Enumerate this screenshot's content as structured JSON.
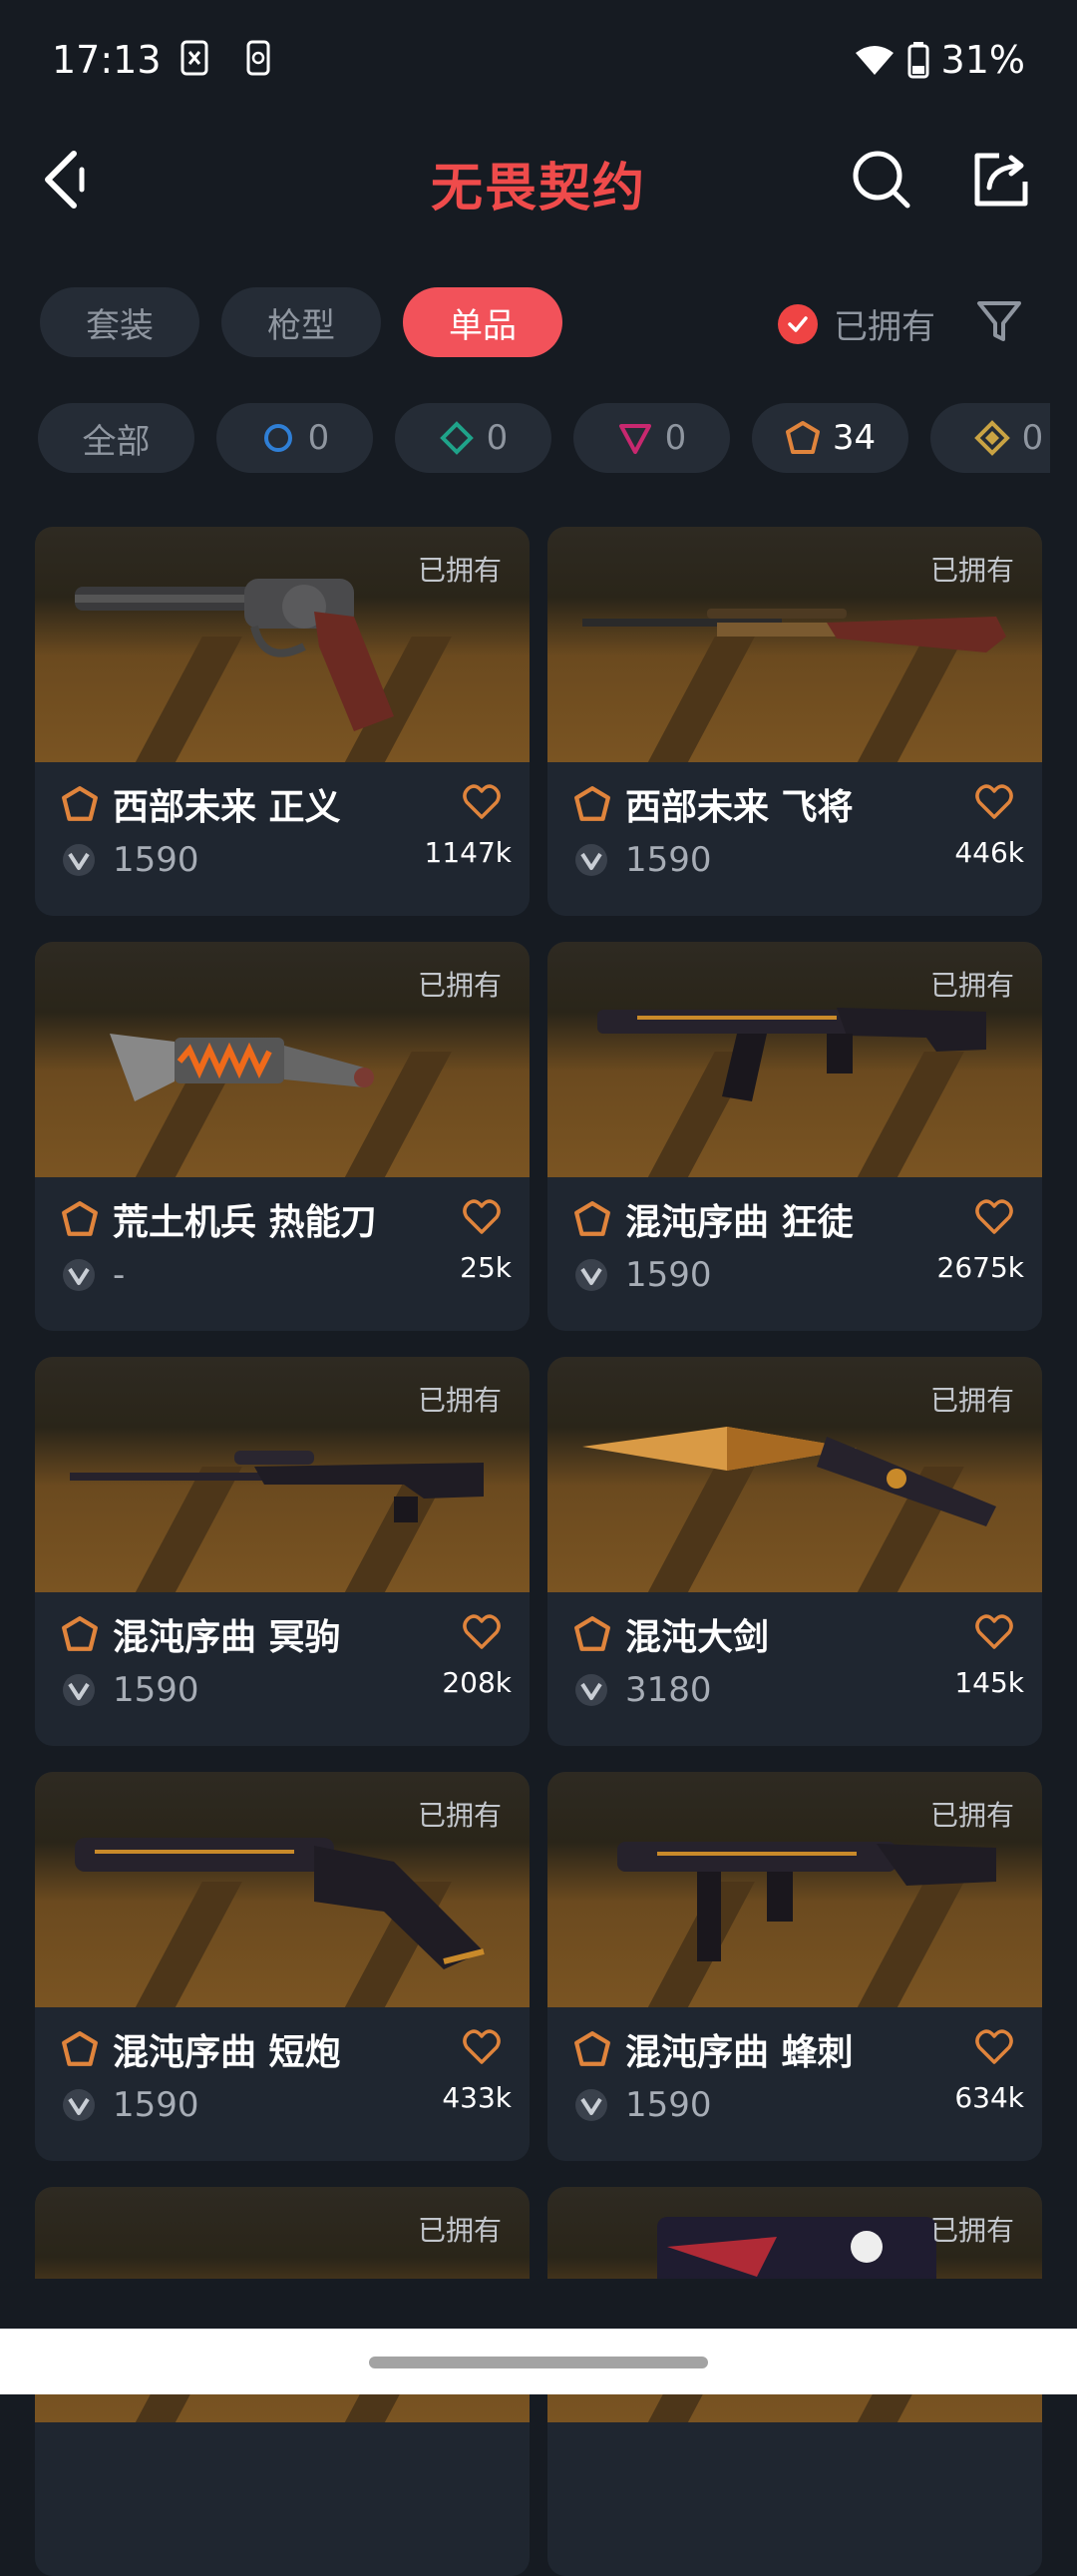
{
  "status": {
    "time": "17:13",
    "battery": "31%"
  },
  "header": {
    "title": "无畏契约"
  },
  "tabs": [
    {
      "label": "套装",
      "active": false
    },
    {
      "label": "枪型",
      "active": false
    },
    {
      "label": "单品",
      "active": true
    }
  ],
  "owned_filter": {
    "label": "已拥有",
    "checked": true
  },
  "rarity_chips": [
    {
      "label": "全部",
      "color": ""
    },
    {
      "count": "0",
      "color": "#2f7fd6",
      "icon": "select-tier-icon"
    },
    {
      "count": "0",
      "color": "#1fa38a",
      "icon": "deluxe-tier-icon"
    },
    {
      "count": "0",
      "color": "#c8286f",
      "icon": "premium-tier-icon"
    },
    {
      "count": "34",
      "color": "#e0843c",
      "icon": "exclusive-tier-icon",
      "selected": true
    },
    {
      "count": "0",
      "color": "#c9a343",
      "icon": "ultra-tier-icon"
    }
  ],
  "cards": [
    {
      "owned": "已拥有",
      "name": "西部未来 正义",
      "price": "1590",
      "likes": "1147k",
      "weapon": "revolver"
    },
    {
      "owned": "已拥有",
      "name": "西部未来 飞将",
      "price": "1590",
      "likes": "446k",
      "weapon": "rifle-wood"
    },
    {
      "owned": "已拥有",
      "name": "荒土机兵 热能刀",
      "price": "-",
      "likes": "25k",
      "weapon": "knife"
    },
    {
      "owned": "已拥有",
      "name": "混沌序曲 狂徒",
      "price": "1590",
      "likes": "2675k",
      "weapon": "vandal"
    },
    {
      "owned": "已拥有",
      "name": "混沌序曲 冥驹",
      "price": "1590",
      "likes": "208k",
      "weapon": "sniper"
    },
    {
      "owned": "已拥有",
      "name": "混沌大剑",
      "price": "3180",
      "likes": "145k",
      "weapon": "sword"
    },
    {
      "owned": "已拥有",
      "name": "混沌序曲 短炮",
      "price": "1590",
      "likes": "433k",
      "weapon": "shotgun"
    },
    {
      "owned": "已拥有",
      "name": "混沌序曲 蜂刺",
      "price": "1590",
      "likes": "634k",
      "weapon": "smg"
    },
    {
      "owned": "已拥有",
      "name": "",
      "price": "",
      "likes": "",
      "weapon": "partial-green"
    },
    {
      "owned": "已拥有",
      "name": "",
      "price": "",
      "likes": "",
      "weapon": "partial-edg"
    }
  ],
  "colors": {
    "accent": "#f2525a",
    "exclusive": "#e0843c",
    "heart": "#e0843c"
  }
}
